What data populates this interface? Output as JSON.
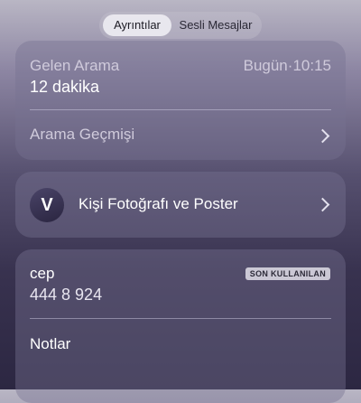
{
  "segmented_control": {
    "details_label": "Ayrıntılar",
    "voicemail_label": "Sesli Mesajlar"
  },
  "call_card": {
    "call_type": "Gelen Arama",
    "date_label": "Bugün",
    "separator": "·",
    "time": "10:15",
    "duration": "12 dakika",
    "history_label": "Arama Geçmişi"
  },
  "contact_photo_card": {
    "avatar_initial": "V",
    "label": "Kişi Fotoğrafı ve Poster"
  },
  "phone_card": {
    "phone_type": "cep",
    "phone_number": "444 8 924",
    "badge": "SON KULLANILAN",
    "notes_label": "Notlar"
  },
  "colors": {
    "card_background": "#6f6a8a",
    "text_primary": "#ffffff",
    "text_secondary": "#cfcadb"
  }
}
